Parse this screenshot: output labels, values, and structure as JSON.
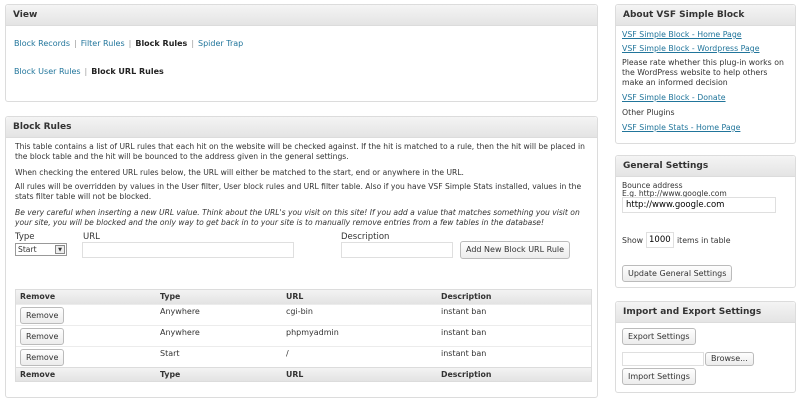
{
  "view": {
    "title": "View",
    "links_row1": [
      "Block Records",
      "Filter Rules",
      "Block Rules",
      "Spider Trap"
    ],
    "links_row2": [
      "Block User Rules",
      "Block URL Rules"
    ],
    "separator": "|"
  },
  "block_rules": {
    "title": "Block Rules",
    "para1": "This table contains a list of URL rules that each hit on the website will be checked against. If the hit is matched to a rule, then the hit will be placed in the block table and the hit will be bounced to the address given in the general settings.",
    "para2": "When checking the entered URL rules below, the URL will either be matched to the start, end or anywhere in the URL.",
    "para3": "All rules will be overridden by values in the User filter, User block rules and URL filter table. Also if you have VSF Simple Stats installed, values in the stats filter table will not be blocked.",
    "para4": "Be very careful when inserting a new URL value. Think about the URL's you visit on this site! If you add a value that matches something you visit on your site, you will be blocked and the only way to get back in to your site is to manually remove entries from a few tables in the database!",
    "form": {
      "type_label": "Type",
      "url_label": "URL",
      "description_label": "Description",
      "type_value": "Start",
      "url_value": "",
      "description_value": "",
      "add_button": "Add New Block URL Rule"
    },
    "table": {
      "headers": [
        "Remove",
        "Type",
        "URL",
        "Description"
      ],
      "rows": [
        {
          "remove": "Remove",
          "type": "Anywhere",
          "url": "cgi-bin",
          "description": "instant ban"
        },
        {
          "remove": "Remove",
          "type": "Anywhere",
          "url": "phpmyadmin",
          "description": "instant ban"
        },
        {
          "remove": "Remove",
          "type": "Start",
          "url": "/",
          "description": "instant ban"
        }
      ]
    }
  },
  "about": {
    "title": "About VSF Simple Block",
    "link_home": "VSF Simple Block - Home Page",
    "link_wordpress": "VSF Simple Block - Wordpress Page",
    "rate_text": "Please rate whether this plug-in works on the WordPress website to help others make an informed decision",
    "link_donate": "VSF Simple Block - Donate",
    "other_plugins": "Other Plugins",
    "link_stats": "VSF Simple Stats - Home Page"
  },
  "general": {
    "title": "General Settings",
    "bounce_label": "Bounce address",
    "bounce_example": "E.g. http://www.google.com",
    "bounce_value": "http://www.google.com",
    "show_label": "Show",
    "show_value": "1000",
    "items_label": "items in table",
    "update_button": "Update General Settings"
  },
  "import_export": {
    "title": "Import and Export Settings",
    "export_button": "Export Settings",
    "file_value": "",
    "browse_button": "Browse...",
    "import_button": "Import Settings"
  }
}
